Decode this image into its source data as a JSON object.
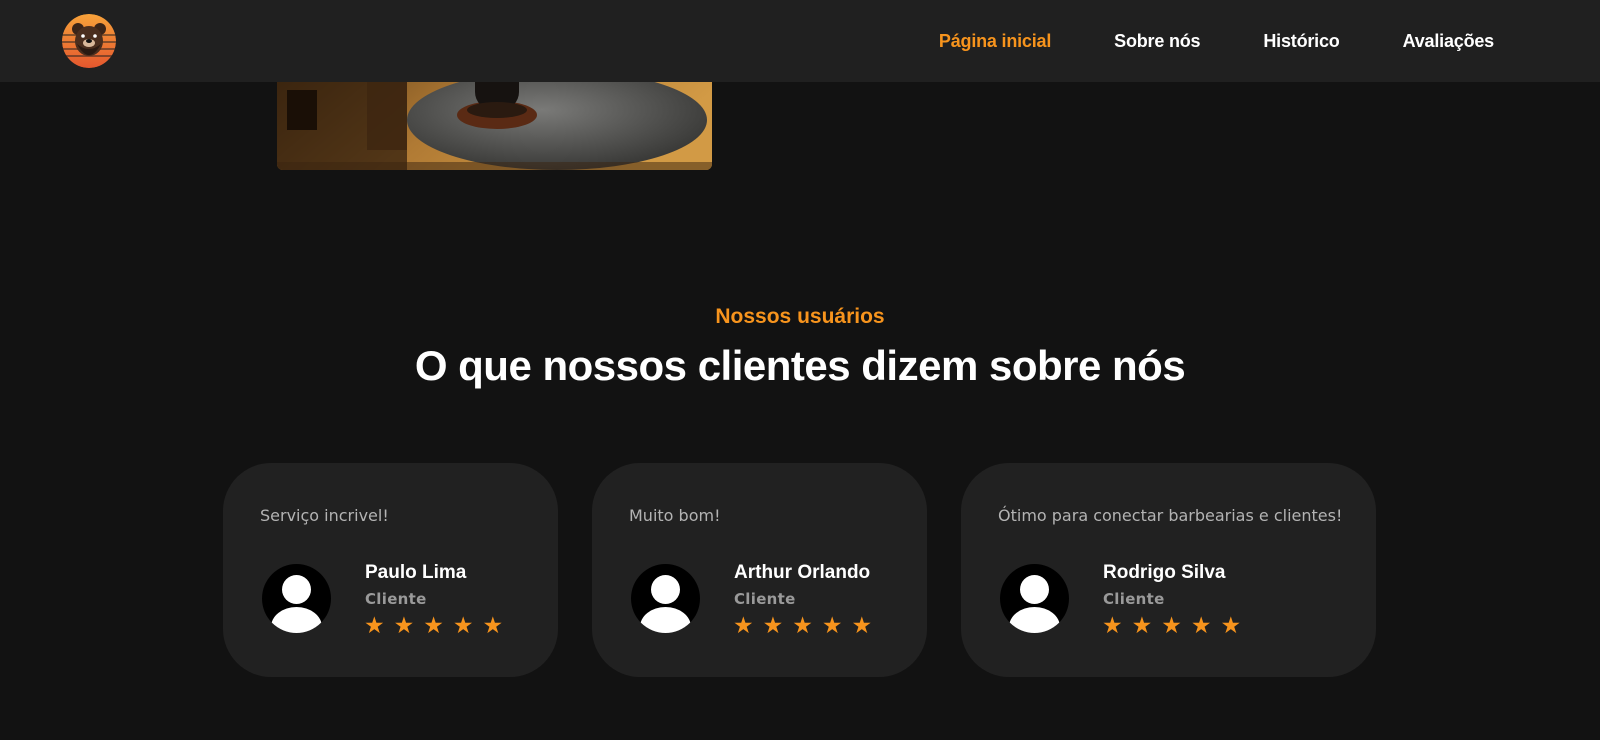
{
  "brand": {
    "logo_icon": "bear-logo-icon",
    "accent": "#f7941d"
  },
  "nav": {
    "items": [
      {
        "label": "Página inicial",
        "active": true
      },
      {
        "label": "Sobre nós",
        "active": false
      },
      {
        "label": "Histórico",
        "active": false
      },
      {
        "label": "Avaliações",
        "active": false
      }
    ]
  },
  "section": {
    "eyebrow": "Nossos usuários",
    "title": "O que nossos clientes dizem sobre nós"
  },
  "testimonials": [
    {
      "text": "Serviço incrivel!",
      "name": "Paulo Lima",
      "role": "Cliente",
      "rating": 5
    },
    {
      "text": "Muito bom!",
      "name": "Arthur Orlando",
      "role": "Cliente",
      "rating": 5
    },
    {
      "text": "Ótimo para conectar barbearias e clientes!",
      "name": "Rodrigo Silva",
      "role": "Cliente",
      "rating": 5
    }
  ],
  "icons": {
    "star": "★",
    "avatar": "user-avatar-icon"
  }
}
